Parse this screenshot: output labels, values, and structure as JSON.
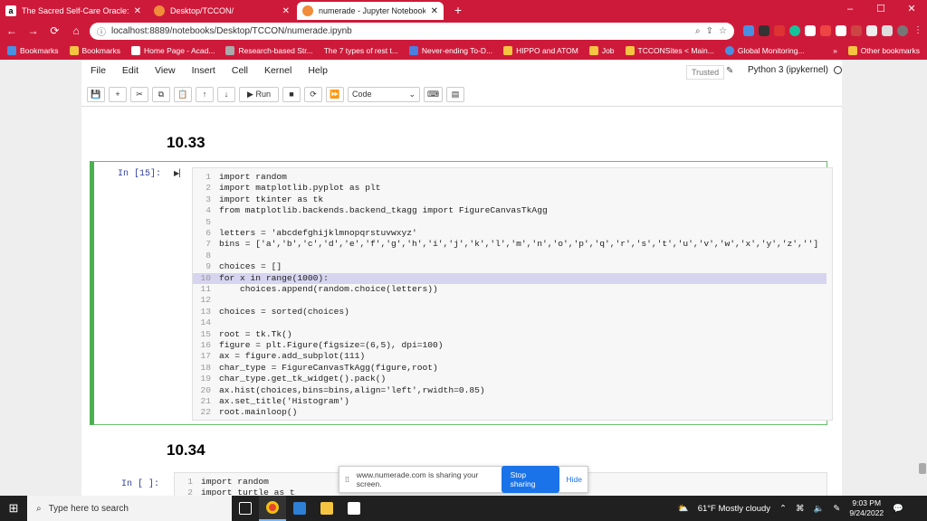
{
  "browser": {
    "tabs": [
      {
        "title": "The Sacred Self-Care Oracle: A S",
        "favicon_color": "#ffffff",
        "active": false
      },
      {
        "title": "Desktop/TCCON/",
        "favicon_color": "#f08c3a",
        "active": false
      },
      {
        "title": "numerade - Jupyter Notebook",
        "favicon_color": "#f08c3a",
        "active": true
      }
    ],
    "new_tab_label": "+",
    "window_controls": [
      "–",
      "☐",
      "✕"
    ],
    "url": "localhost:8889/notebooks/Desktop/TCCON/numerade.ipynb",
    "nav": {
      "back": "←",
      "forward": "→",
      "reload": "⟳",
      "home": "⌂"
    },
    "bookmarks": [
      "Bookmarks",
      "Bookmarks",
      "Home Page - Acad...",
      "Research-based Str...",
      "The 7 types of rest t...",
      "Never-ending To-D...",
      "HIPPO and ATOM",
      "Job",
      "TCCONSites < Main...",
      "Global Monitoring..."
    ],
    "other_bookmarks": "Other bookmarks"
  },
  "jupyter": {
    "menu": [
      "File",
      "Edit",
      "View",
      "Insert",
      "Cell",
      "Kernel",
      "Help"
    ],
    "trusted": "Trusted",
    "kernel": "Python 3 (ipykernel)",
    "toolbar": {
      "run_label": "Run",
      "cell_type": "Code"
    }
  },
  "notebook": {
    "heading1": "10.33",
    "prompt1": "In [15]:",
    "code1": [
      "import random",
      "import matplotlib.pyplot as plt",
      "import tkinter as tk",
      "from matplotlib.backends.backend_tkagg import FigureCanvasTkAgg",
      "",
      "letters = 'abcdefghijklmnopqrstuvwxyz'",
      "bins = ['a','b','c','d','e','f','g','h','i','j','k','l','m','n','o','p','q','r','s','t','u','v','w','x','y','z','']",
      "",
      "choices = []",
      "for x in range(1000):",
      "    choices.append(random.choice(letters))",
      "",
      "choices = sorted(choices)",
      "",
      "root = tk.Tk()",
      "figure = plt.Figure(figsize=(6,5), dpi=100)",
      "ax = figure.add_subplot(111)",
      "char_type = FigureCanvasTkAgg(figure,root)",
      "char_type.get_tk_widget().pack()",
      "ax.hist(choices,bins=bins,align='left',rwidth=0.85)",
      "ax.set_title('Histogram')",
      "root.mainloop()"
    ],
    "highlighted_line": 10,
    "heading2": "10.34",
    "prompt2": "In [ ]:",
    "code2": [
      "import random",
      "import turtle as t"
    ]
  },
  "share_bar": {
    "text": "www.numerade.com is sharing your screen.",
    "stop": "Stop sharing",
    "hide": "Hide"
  },
  "taskbar": {
    "search_placeholder": "Type here to search",
    "weather": "61°F  Mostly cloudy",
    "time": "9:03 PM",
    "date": "9/24/2022"
  }
}
